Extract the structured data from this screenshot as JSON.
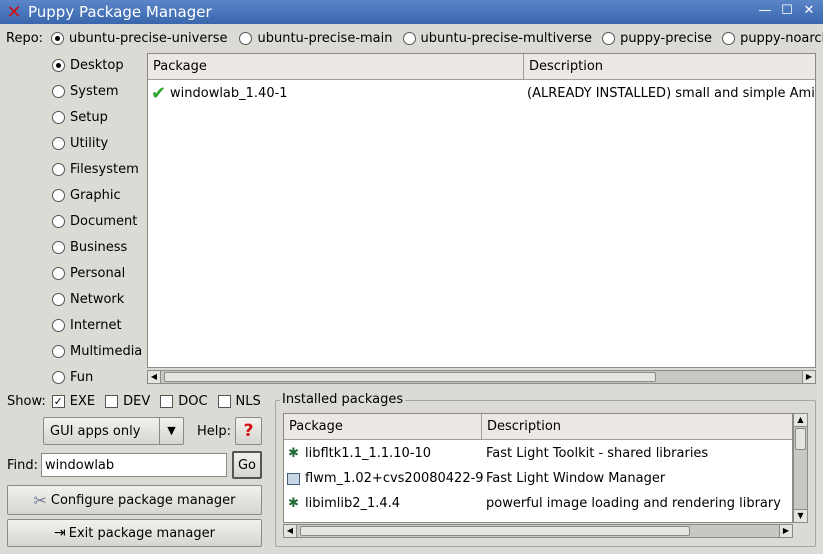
{
  "window": {
    "title": "Puppy Package Manager"
  },
  "repo": {
    "label": "Repo:",
    "options": [
      "ubuntu-precise-universe",
      "ubuntu-precise-main",
      "ubuntu-precise-multiverse",
      "puppy-precise",
      "puppy-noarch"
    ],
    "selected": 0
  },
  "categories": {
    "items": [
      "Desktop",
      "System",
      "Setup",
      "Utility",
      "Filesystem",
      "Graphic",
      "Document",
      "Business",
      "Personal",
      "Network",
      "Internet",
      "Multimedia",
      "Fun"
    ],
    "selected": 0
  },
  "results": {
    "columns": [
      "Package",
      "Description"
    ],
    "rows": [
      {
        "package": "windowlab_1.40-1",
        "description": "(ALREADY INSTALLED) small and simple Amig",
        "icon": "installed-check-icon"
      }
    ]
  },
  "show": {
    "label": "Show:",
    "options": [
      {
        "label": "EXE",
        "checked": true
      },
      {
        "label": "DEV",
        "checked": false
      },
      {
        "label": "DOC",
        "checked": false
      },
      {
        "label": "NLS",
        "checked": false
      }
    ]
  },
  "filter": {
    "value": "GUI apps only"
  },
  "help": {
    "label": "Help:",
    "icon": "question-icon"
  },
  "find": {
    "label": "Find:",
    "value": "windowlab",
    "go_label": "Go"
  },
  "buttons": {
    "configure": "Configure package manager",
    "exit": "Exit package manager"
  },
  "installed": {
    "title": "Installed packages",
    "columns": [
      "Package",
      "Description"
    ],
    "rows": [
      {
        "package": "libfltk1.1_1.1.10-10",
        "description": "Fast Light Toolkit - shared libraries",
        "icon": "library-icon"
      },
      {
        "package": "flwm_1.02+cvs20080422-9",
        "description": "Fast Light Window Manager",
        "icon": "window-icon"
      },
      {
        "package": "libimlib2_1.4.4",
        "description": "powerful image loading and rendering library",
        "icon": "library-icon"
      }
    ]
  },
  "colors": {
    "titlebar": "#3a66ad",
    "check": "#2aa52a",
    "help": "#d01010"
  }
}
